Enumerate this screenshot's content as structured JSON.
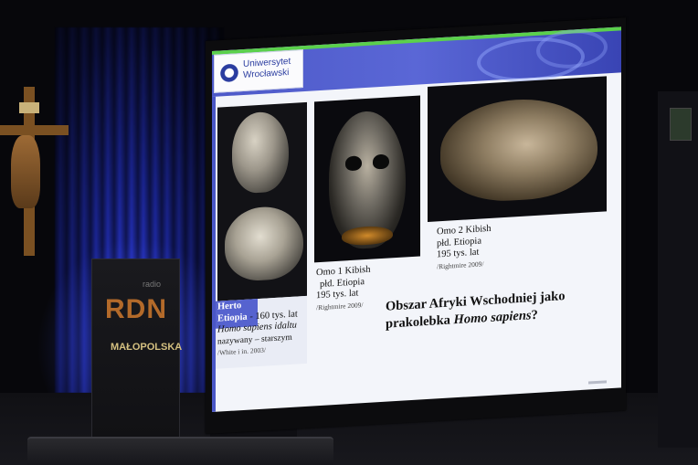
{
  "scene": {
    "banner": {
      "small_text": "radio",
      "logo_text": "RDN",
      "region": "MAŁOPOLSKA"
    }
  },
  "slide": {
    "logo": {
      "line1": "Uniwersytet",
      "line2": "Wrocławski"
    },
    "specimens": [
      {
        "name": "Herto",
        "location": "Etiopia",
        "age": "- 160 tys. lat",
        "line3": "Homo sapiens idaltu",
        "line4": "nazywany – starszym",
        "citation": "/White i in. 2003/"
      },
      {
        "name": "Omo 1 Kibish",
        "location": "płd. Etiopia",
        "age": "195 tys. lat",
        "citation": "/Rightmire 2009/"
      },
      {
        "name": "Omo 2 Kibish",
        "location": "płd. Etiopia",
        "age": "195 tys. lat",
        "citation": "/Rightmire 2009/"
      }
    ],
    "headline": {
      "line1": "Obszar Afryki Wschodniej jako",
      "line2_prefix": "prakolebka ",
      "line2_italic": "Homo sapiens",
      "line2_suffix": "?"
    }
  },
  "colors": {
    "header_blue": "#4d59c8",
    "header_green": "#5bd04c",
    "curtain_blue": "#2c3ad8"
  }
}
